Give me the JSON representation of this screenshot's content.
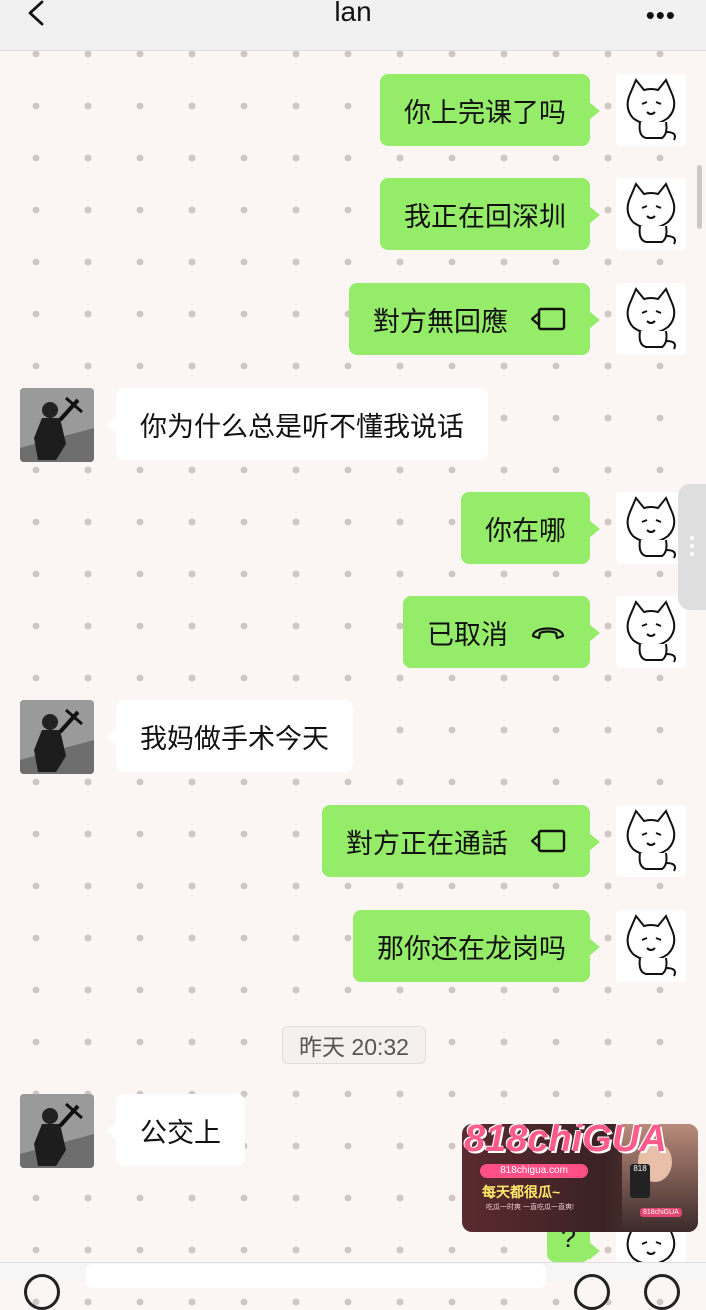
{
  "header": {
    "title": "lan",
    "back_icon": "chevron-left-icon",
    "more_label": "•••"
  },
  "messages": [
    {
      "side": "me",
      "text": "你上完课了吗"
    },
    {
      "side": "me",
      "text": "我正在回深圳"
    },
    {
      "side": "me",
      "text": "對方無回應",
      "icon": "video-call-icon"
    },
    {
      "side": "them",
      "text": "你为什么总是听不懂我说话"
    },
    {
      "side": "me",
      "text": "你在哪"
    },
    {
      "side": "me",
      "text": "已取消",
      "icon": "phone-hangup-icon"
    },
    {
      "side": "them",
      "text": "我妈做手术今天"
    },
    {
      "side": "me",
      "text": "對方正在通話",
      "icon": "video-call-icon"
    },
    {
      "side": "me",
      "text": "那你还在龙岗吗"
    },
    {
      "side": "them",
      "text": "公交上"
    }
  ],
  "timestamp": "昨天 20:32",
  "partial_bubble_text": "?",
  "ad": {
    "brand": "818chiGUA",
    "url": "818chigua.com",
    "slogan": "每天都很瓜~",
    "tagline": "吃瓜一时爽 一直吃瓜一直爽!",
    "badge": "818chiGUA",
    "phone_label": "818"
  },
  "colors": {
    "my_bubble": "#95ec69",
    "their_bubble": "#ffffff",
    "background": "#fbf6f4"
  }
}
